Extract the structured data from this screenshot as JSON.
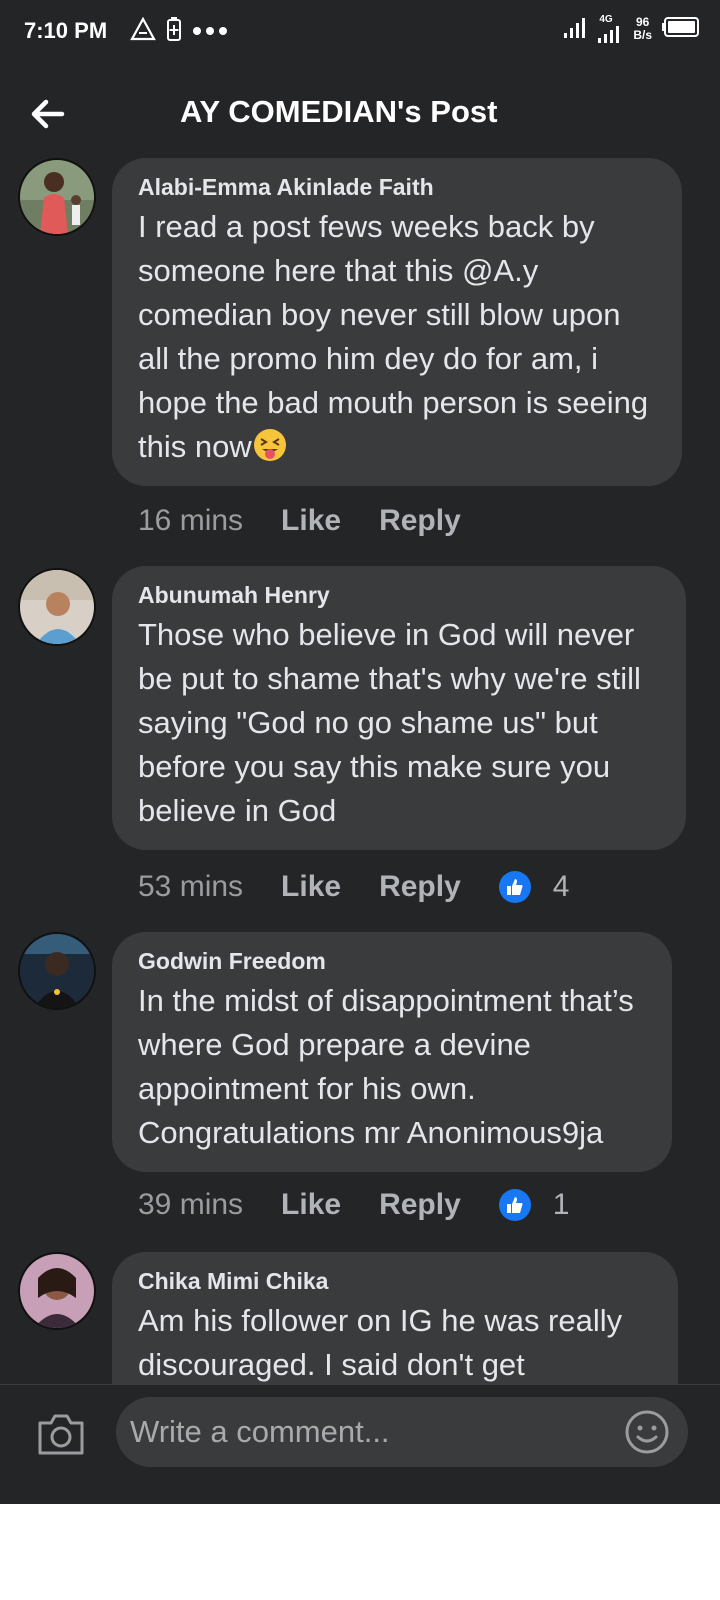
{
  "status_bar": {
    "time": "7:10 PM",
    "net_type": "4G",
    "net_speed_value": "96",
    "net_speed_unit": "B/s"
  },
  "header": {
    "title": "AY COMEDIAN's Post"
  },
  "comments": [
    {
      "author": "Alabi-Emma Akinlade Faith",
      "text": "I read a post fews weeks back by someone here that this @A.y comedian boy never still blow upon all the promo him dey do for am, i hope the bad mouth person is seeing this now",
      "emoji": "squinting-tongue-face-icon",
      "time": "16 mins",
      "like_label": "Like",
      "reply_label": "Reply",
      "reactions": ""
    },
    {
      "author": "Abunumah Henry",
      "text": "Those who believe in God will never be put to shame that's why we're still saying \"God no go shame us\" but before you say this make sure you believe in God",
      "time": "53 mins",
      "like_label": "Like",
      "reply_label": "Reply",
      "reactions": "4"
    },
    {
      "author": "Godwin Freedom",
      "text": "In the midst of disappointment that’s where God prepare a devine appointment for his own. Congratulations mr Anonimous9ja",
      "time": "39 mins",
      "like_label": "Like",
      "reply_label": "Reply",
      "reactions": "1"
    },
    {
      "author": "Chika Mimi Chika",
      "text": "Am his follower on IG he was really discouraged. I said don't get"
    }
  ],
  "composer": {
    "placeholder": "Write a comment..."
  },
  "colors": {
    "background": "#242527",
    "bubble": "#3a3b3d",
    "like_blue": "#1877f2"
  }
}
